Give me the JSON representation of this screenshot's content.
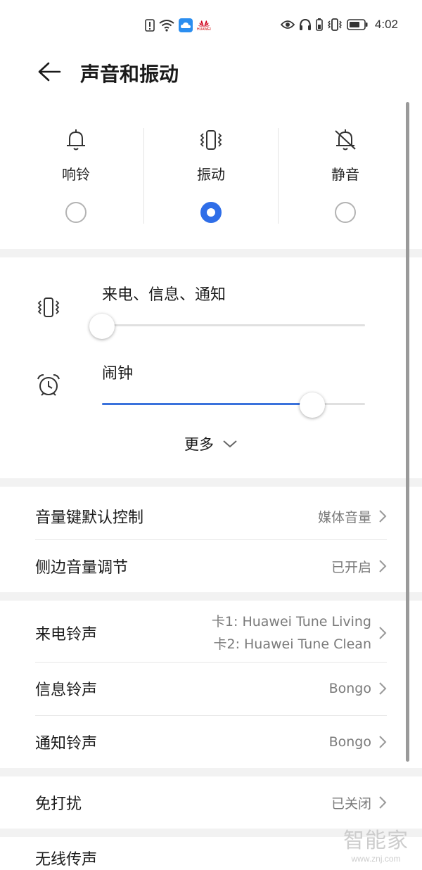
{
  "status_bar": {
    "time": "4:02",
    "brand_mini": "HUAWEI",
    "icons": [
      "alert-icon",
      "wifi-icon",
      "cloud-icon",
      "huawei-logo-icon",
      "eye-icon",
      "headphones-icon",
      "battery-small-icon",
      "vibrate-status-icon",
      "battery-icon"
    ]
  },
  "header": {
    "title": "声音和振动",
    "back_icon": "back-arrow-icon"
  },
  "modes": [
    {
      "label": "响铃",
      "icon": "bell-icon",
      "selected": false
    },
    {
      "label": "振动",
      "icon": "vibrate-icon",
      "selected": true
    },
    {
      "label": "静音",
      "icon": "bell-off-icon",
      "selected": false
    }
  ],
  "volume": {
    "sliders": [
      {
        "label": "来电、信息、通知",
        "icon": "vibrate-icon",
        "level": 0.0
      },
      {
        "label": "闹钟",
        "icon": "alarm-clock-icon",
        "level": 0.8
      }
    ],
    "more_label": "更多"
  },
  "settings_group1": [
    {
      "title": "音量键默认控制",
      "value": "媒体音量"
    },
    {
      "title": "侧边音量调节",
      "value": "已开启"
    }
  ],
  "settings_group2": [
    {
      "title": "来电铃声",
      "value_lines": [
        "卡1: Huawei Tune Living",
        "卡2: Huawei Tune Clean"
      ]
    },
    {
      "title": "信息铃声",
      "value": "Bongo"
    },
    {
      "title": "通知铃声",
      "value": "Bongo"
    }
  ],
  "settings_group3": [
    {
      "title": "免打扰",
      "value": "已关闭"
    }
  ],
  "settings_group4": [
    {
      "title": "无线传声"
    }
  ],
  "watermark": {
    "brand": "智能家",
    "url": "www.znj.com"
  },
  "colors": {
    "accent": "#2f6ee8",
    "slider_fill": "#3a72dc",
    "background": "#f2f2f2",
    "card": "#ffffff",
    "secondary_text": "#7a7a7a"
  }
}
